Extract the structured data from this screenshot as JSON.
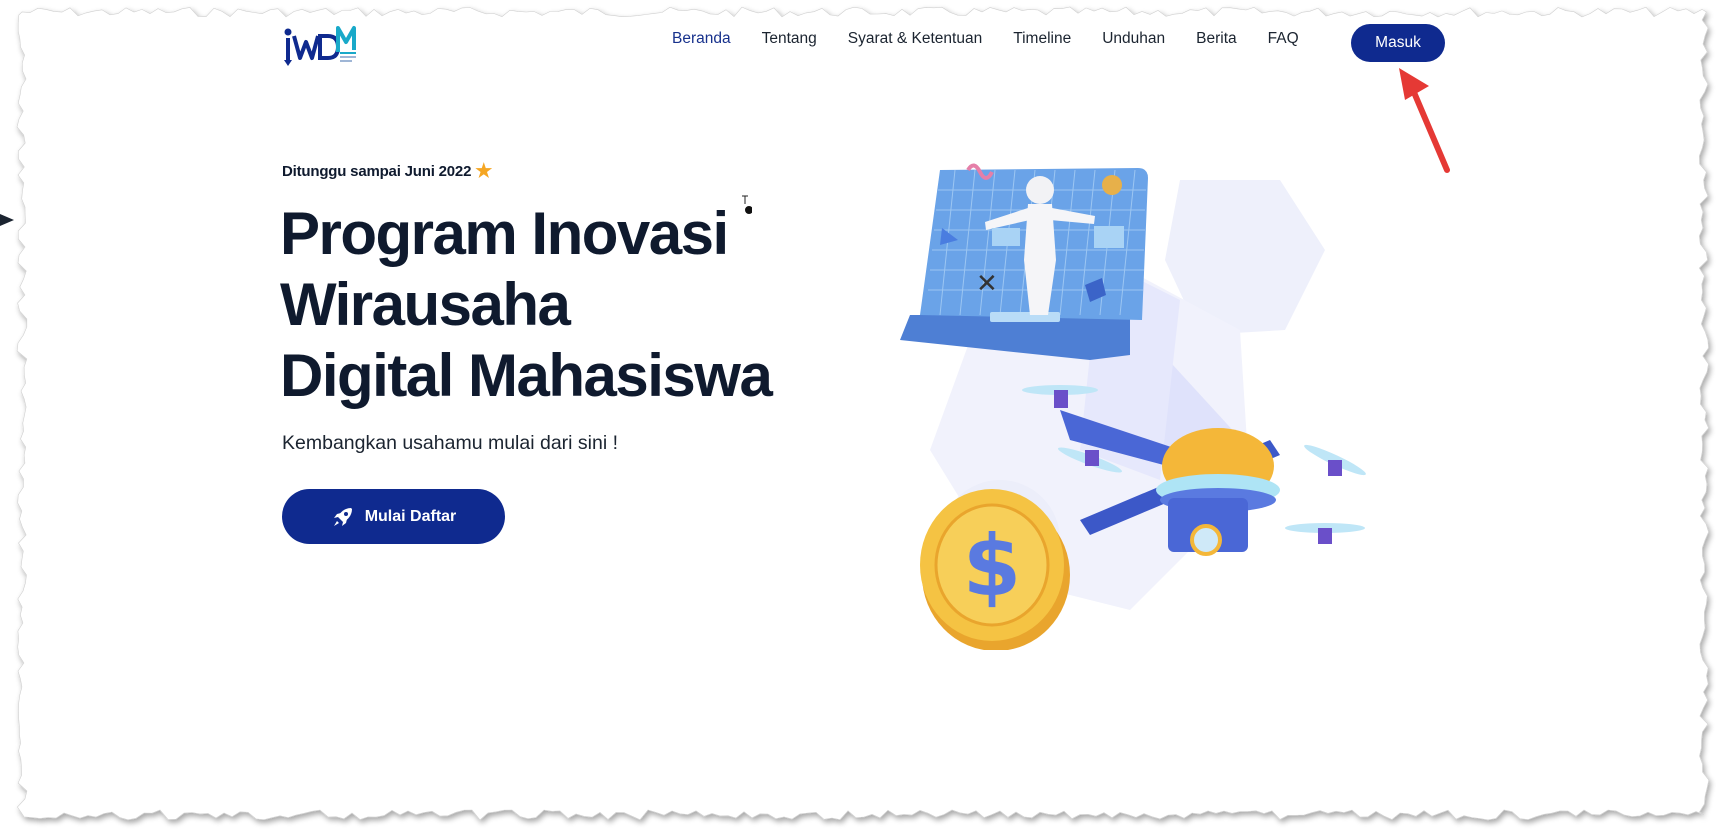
{
  "nav": {
    "items": [
      {
        "label": "Beranda",
        "active": true
      },
      {
        "label": "Tentang",
        "active": false
      },
      {
        "label": "Syarat & Ketentuan",
        "active": false
      },
      {
        "label": "Timeline",
        "active": false
      },
      {
        "label": "Unduhan",
        "active": false
      },
      {
        "label": "Berita",
        "active": false
      },
      {
        "label": "FAQ",
        "active": false
      }
    ],
    "login_label": "Masuk"
  },
  "hero": {
    "eyebrow": "Ditunggu sampai Juni 2022",
    "eyebrow_icon": "star-icon",
    "title_lines": [
      "Program Inovasi",
      "Wirausaha",
      "Digital Mahasiswa"
    ],
    "subtitle": "Kembangkan usahamu mulai dari sini !",
    "cta_label": "Mulai Daftar",
    "cta_icon": "rocket-icon"
  },
  "colors": {
    "primary": "#0f2a8f",
    "text": "#0f1a2e",
    "accent_star": "#f5a623",
    "annotation_arrow": "#e53935"
  }
}
